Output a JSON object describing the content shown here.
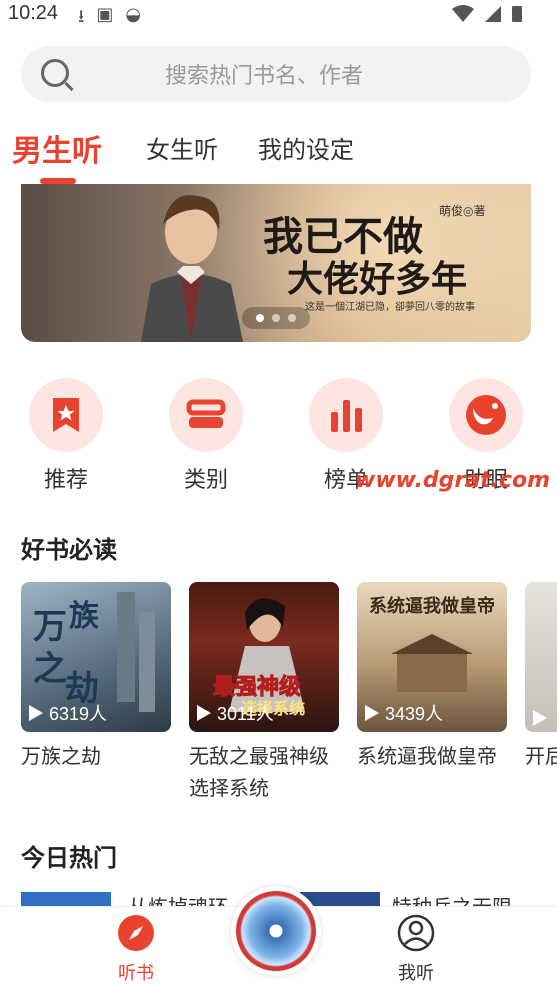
{
  "status_bar": {
    "time": "10:24"
  },
  "search": {
    "placeholder": "搜索热门书名、作者"
  },
  "tabs": [
    {
      "label": "男生听",
      "active": true
    },
    {
      "label": "女生听",
      "active": false
    },
    {
      "label": "我的设定",
      "active": false
    }
  ],
  "banner": {
    "title_line1": "我已不做",
    "title_line2": "大佬好多年",
    "author": "萌俊◎著",
    "subtitle": "这是一個江湖已隐，卻夢回八零的故事",
    "slide_count": 3,
    "active_slide": 1
  },
  "categories": [
    {
      "label": "推荐",
      "icon": "bookmark-star-icon"
    },
    {
      "label": "类别",
      "icon": "category-icon"
    },
    {
      "label": "榜单",
      "icon": "bar-chart-icon"
    },
    {
      "label": "助眠",
      "icon": "moon-icon"
    }
  ],
  "watermark": "www.dgrat.com",
  "sections": {
    "must_read": "好书必读",
    "today_hot": "今日热门"
  },
  "books": [
    {
      "title": "万族之劫",
      "listeners": "6319人",
      "cover_text": "万族之劫"
    },
    {
      "title": "无敌之最强神级选择系统",
      "listeners": "3011人",
      "cover_text": "最强神级选择系统"
    },
    {
      "title": "系统逼我做皇帝",
      "listeners": "3439人",
      "cover_text": "系统逼我做皇帝"
    },
    {
      "title": "开后",
      "listeners": "",
      "cover_text": ""
    }
  ],
  "hot_preview": [
    {
      "text": "从炼掉魂环"
    },
    {
      "text": "特种兵之无限"
    }
  ],
  "bottom_nav": [
    {
      "label": "听书",
      "icon": "compass-icon",
      "active": true
    },
    {
      "label": "我听",
      "icon": "user-icon",
      "active": false
    }
  ],
  "colors": {
    "accent": "#e8432e",
    "icon_bg": "#fde6e2"
  }
}
